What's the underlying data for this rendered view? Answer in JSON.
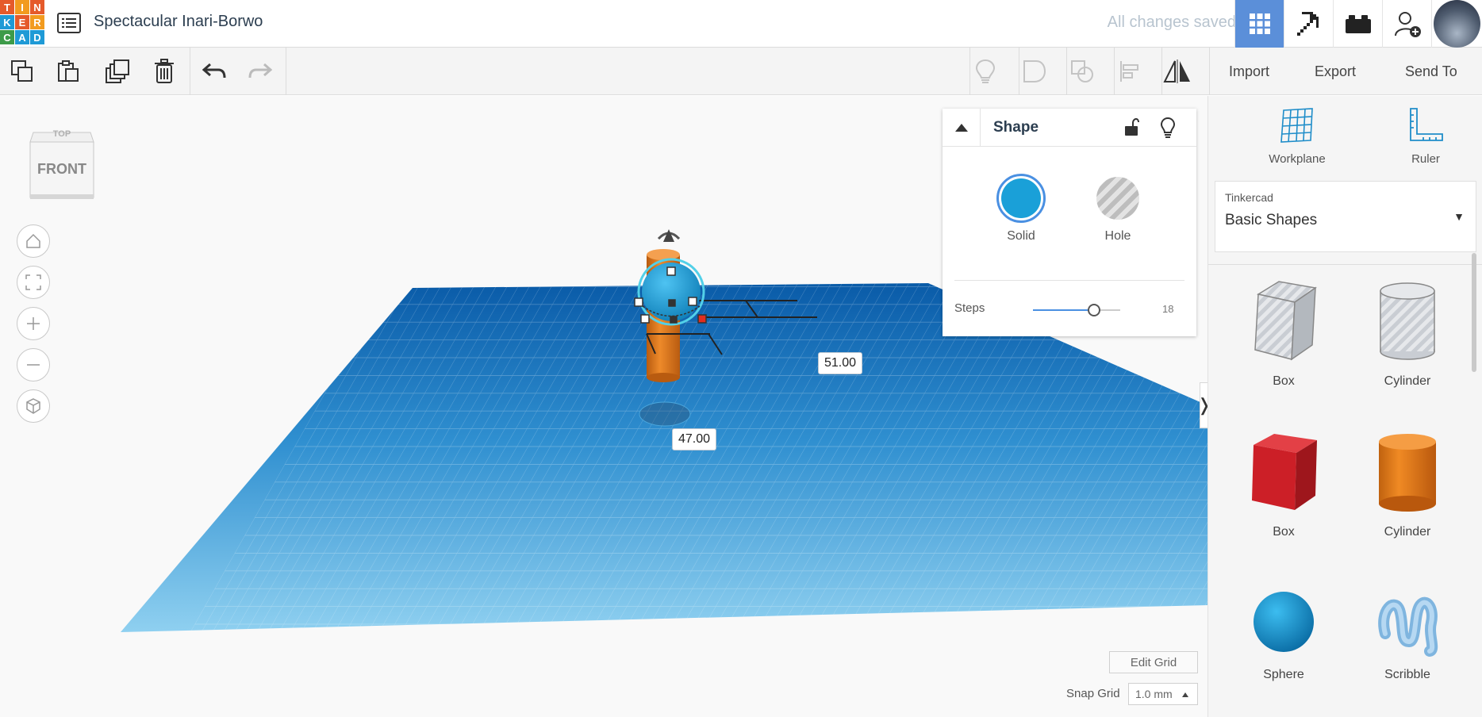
{
  "logo": {
    "letters": [
      "T",
      "I",
      "N",
      "K",
      "E",
      "R",
      "C",
      "A",
      "D"
    ],
    "colors": [
      "#e55a2b",
      "#f29b1f",
      "#e55a2b",
      "#1f9ad6",
      "#e55a2b",
      "#f29b1f",
      "#3d9b49",
      "#1f9ad6",
      "#1f9ad6"
    ]
  },
  "header": {
    "design_title": "Spectacular Inari-Borwo",
    "save_status": "All changes saved",
    "icons": [
      "grid-view-icon",
      "pickaxe-icon",
      "brick-icon",
      "add-user-icon"
    ]
  },
  "toolbar": {
    "import_label": "Import",
    "export_label": "Export",
    "send_to_label": "Send To"
  },
  "viewcube": {
    "face_front": "FRONT",
    "face_top": "TOP"
  },
  "dimensions": {
    "width_label": "51.00",
    "depth_label": "47.00"
  },
  "grid": {
    "edit_label": "Edit Grid",
    "snap_label": "Snap Grid",
    "snap_value": "1.0 mm"
  },
  "inspector": {
    "title": "Shape",
    "solid_label": "Solid",
    "hole_label": "Hole",
    "steps_label": "Steps",
    "steps_value": "18",
    "steps_fraction": 0.7,
    "solid_color": "#1aa0d8"
  },
  "right_panel": {
    "workplane_label": "Workplane",
    "ruler_label": "Ruler",
    "library_provider": "Tinkercad",
    "library_name": "Basic Shapes",
    "shapes": [
      {
        "label": "Box"
      },
      {
        "label": "Cylinder"
      },
      {
        "label": "Box"
      },
      {
        "label": "Cylinder"
      },
      {
        "label": "Sphere"
      },
      {
        "label": "Scribble"
      }
    ]
  },
  "colors": {
    "accent": "#5b8fd9",
    "grid": "#4aa6dc",
    "cylinder": "#e37518",
    "sphere": "#1aa0d8",
    "box": "#d3232b"
  }
}
